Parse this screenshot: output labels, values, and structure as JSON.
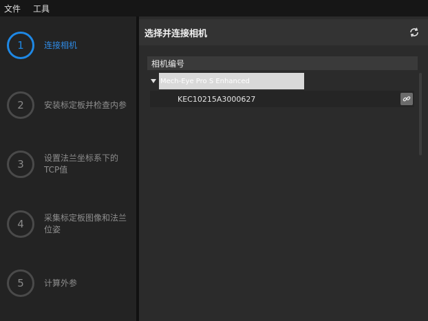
{
  "menu": {
    "file": "文件",
    "tools": "工具"
  },
  "steps": [
    {
      "number": "1",
      "label": "连接相机"
    },
    {
      "number": "2",
      "label": "安装标定板并检查内参"
    },
    {
      "number": "3",
      "label": "设置法兰坐标系下的\nTCP值"
    },
    {
      "number": "4",
      "label": "采集标定板图像和法兰\n位姿"
    },
    {
      "number": "5",
      "label": "计算外参"
    }
  ],
  "panel": {
    "title": "选择并连接相机",
    "refresh_icon": "refresh-icon",
    "column_header": "相机编号",
    "group": {
      "name": "Mech-Eye Pro S Enhanced"
    },
    "device": {
      "id": "KEC10215A3000627",
      "connect_icon": "link-icon"
    }
  },
  "colors": {
    "accent": "#1e88e5",
    "inactive": "#4a4a4a"
  }
}
